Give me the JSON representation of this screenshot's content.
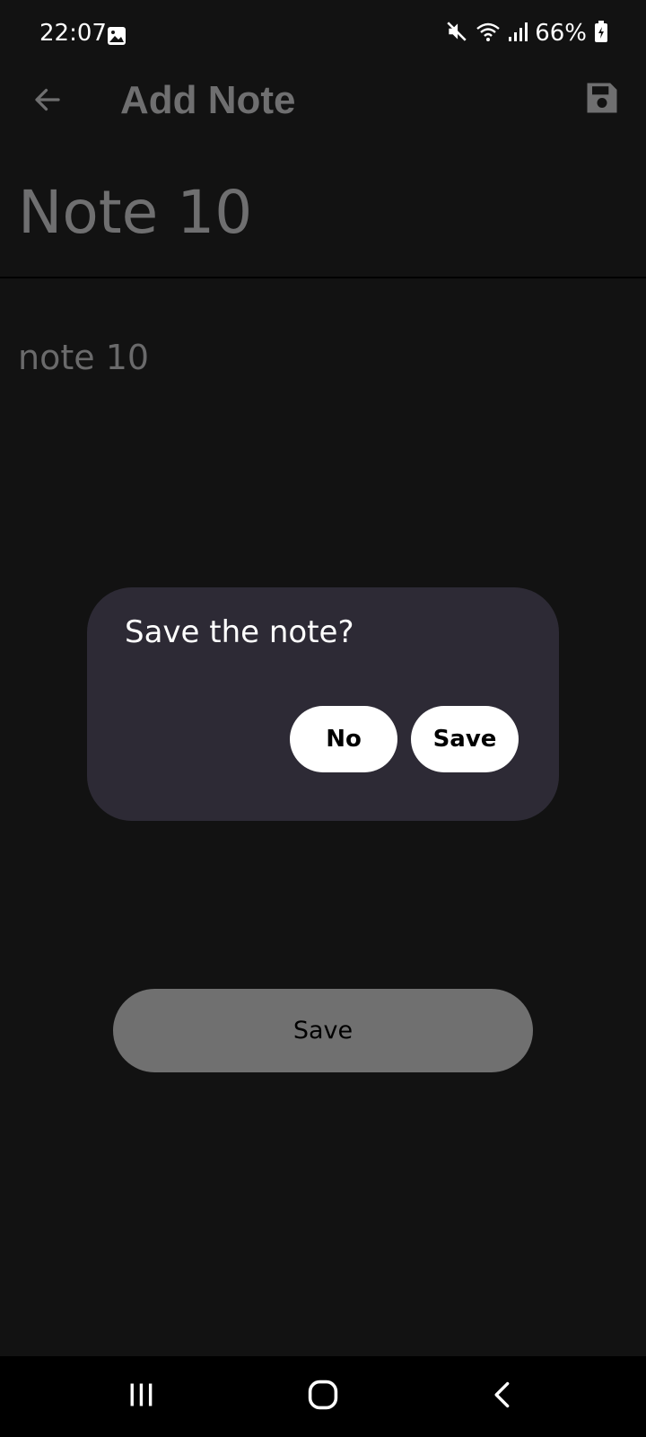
{
  "status_bar": {
    "time": "22:07",
    "battery": "66%",
    "icons": [
      "gallery-icon",
      "mute-icon",
      "wifi-icon",
      "signal-icon",
      "battery-icon"
    ]
  },
  "app_bar": {
    "title": "Add Note",
    "back_icon": "arrow-back-icon",
    "save_icon": "floppy-disk-icon"
  },
  "note": {
    "title_value": "Note 10",
    "content_value": "note 10"
  },
  "dialog": {
    "message": "Save the note?",
    "no_label": "No",
    "save_label": "Save"
  },
  "bottom_button": {
    "label": "Save"
  },
  "nav_bar": {
    "icons": [
      "recents-icon",
      "home-icon",
      "back-icon"
    ]
  },
  "colors": {
    "background": "#121212",
    "dialog_background": "#2d2a35",
    "muted_text": "#6f6f70",
    "bottom_button": "#707070"
  }
}
